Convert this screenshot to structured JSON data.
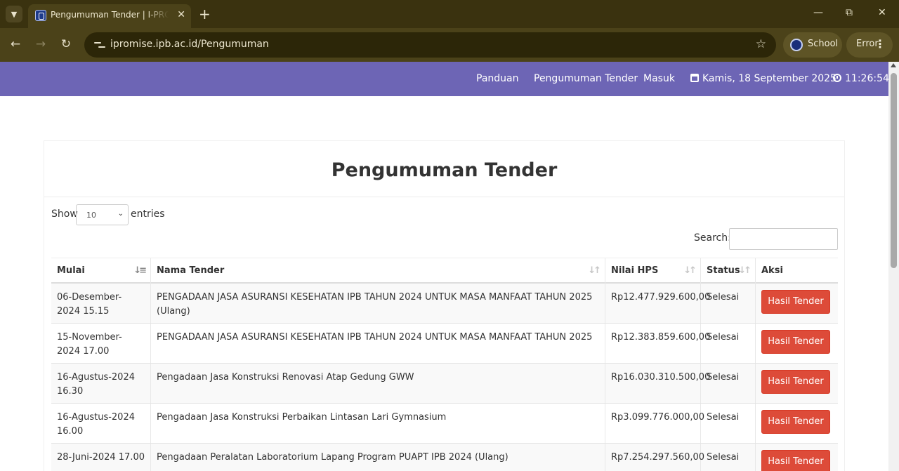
{
  "browser": {
    "tab_title": "Pengumuman Tender | I-PROMISE",
    "url": "ipromise.ipb.ac.id/Pengumuman",
    "profile_label": "School",
    "error_label": "Error"
  },
  "nav": {
    "links": [
      "Panduan",
      "Pengumuman Tender",
      "Masuk"
    ],
    "date": "Kamis, 18 September 2025",
    "time": "11:26:54"
  },
  "page": {
    "title": "Pengumuman Tender",
    "show_label": "Show",
    "entries_value": "10",
    "entries_label": "entries",
    "search_label": "Search:"
  },
  "table": {
    "headers": [
      "Mulai",
      "Nama Tender",
      "Nilai HPS",
      "Status",
      "Aksi"
    ],
    "rows": [
      {
        "mulai": "06-Desember-2024 15.15",
        "nama": "PENGADAAN JASA ASURANSI KESEHATAN IPB TAHUN 2024 UNTUK MASA MANFAAT TAHUN 2025 (Ulang)",
        "hps": "Rp12.477.929.600,00",
        "status": "Selesai",
        "aksi": "Hasil Tender"
      },
      {
        "mulai": "15-November-2024 17.00",
        "nama": "PENGADAAN JASA ASURANSI KESEHATAN IPB TAHUN 2024 UNTUK MASA MANFAAT TAHUN 2025",
        "hps": "Rp12.383.859.600,00",
        "status": "Selesai",
        "aksi": "Hasil Tender"
      },
      {
        "mulai": "16-Agustus-2024 16.30",
        "nama": "Pengadaan Jasa Konstruksi Renovasi Atap Gedung GWW",
        "hps": "Rp16.030.310.500,00",
        "status": "Selesai",
        "aksi": "Hasil Tender"
      },
      {
        "mulai": "16-Agustus-2024 16.00",
        "nama": "Pengadaan Jasa Konstruksi Perbaikan Lintasan Lari Gymnasium",
        "hps": "Rp3.099.776.000,00",
        "status": "Selesai",
        "aksi": "Hasil Tender"
      },
      {
        "mulai": "28-Juni-2024 17.00",
        "nama": "Pengadaan Peralatan Laboratorium Lapang Program PUAPT IPB 2024 (Ulang)",
        "hps": "Rp7.254.297.560,00",
        "status": "Selesai",
        "aksi": "Hasil Tender"
      }
    ]
  }
}
